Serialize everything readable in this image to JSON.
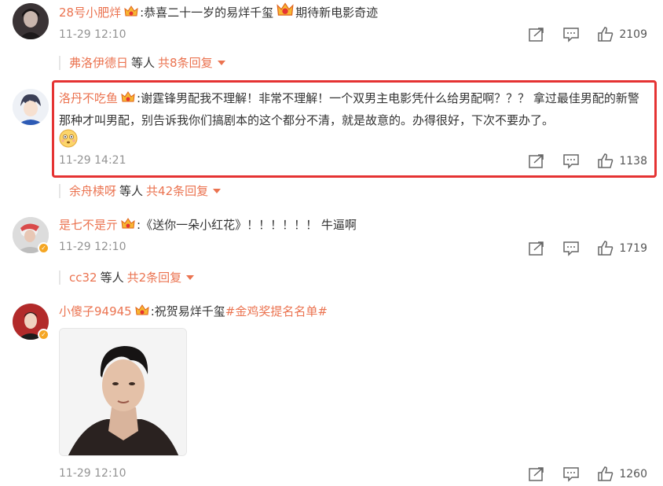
{
  "comments": [
    {
      "username": "28号小肥烊",
      "text_a": ":恭喜二十一岁的易烊千玺",
      "text_b": "期待新电影奇迹",
      "time": "11-29 12:10",
      "likes": "2109",
      "replies": {
        "first_replier": "弗洛伊德日",
        "middle": "等人",
        "count_text": "共8条回复"
      }
    },
    {
      "username": "洛丹不吃鱼",
      "text": ":谢霆锋男配我不理解！非常不理解！一个双男主电影凭什么给男配啊？？？ 拿过最佳男配的新警那种才叫男配，别告诉我你们搞剧本的这个都分不清，就是故意的。办得很好，下次不要办了。",
      "emoji": "flushed-emoji",
      "time": "11-29 14:21",
      "likes": "1138",
      "replies": {
        "first_replier": "余舟椟呀",
        "middle": "等人",
        "count_text": "共42条回复"
      }
    },
    {
      "username": "是七不是亓",
      "text": ":《送你一朵小红花》！！！！！！ 牛逼啊",
      "time": "11-29 12:10",
      "likes": "1719",
      "replies": {
        "first_replier": "cc32",
        "middle": "等人",
        "count_text": "共2条回复"
      }
    },
    {
      "username": "小傻子94945",
      "text": ":祝贺易烊千玺",
      "hashtag": "#金鸡奖提名名单#",
      "time": "11-29 12:10",
      "likes": "1260"
    }
  ],
  "colors": {
    "accent": "#eb7350",
    "highlight": "#e53333",
    "meta": "#939393"
  },
  "icons": [
    "share-icon",
    "comment-icon",
    "like-icon",
    "crown-badge-icon",
    "verified-badge-icon"
  ]
}
